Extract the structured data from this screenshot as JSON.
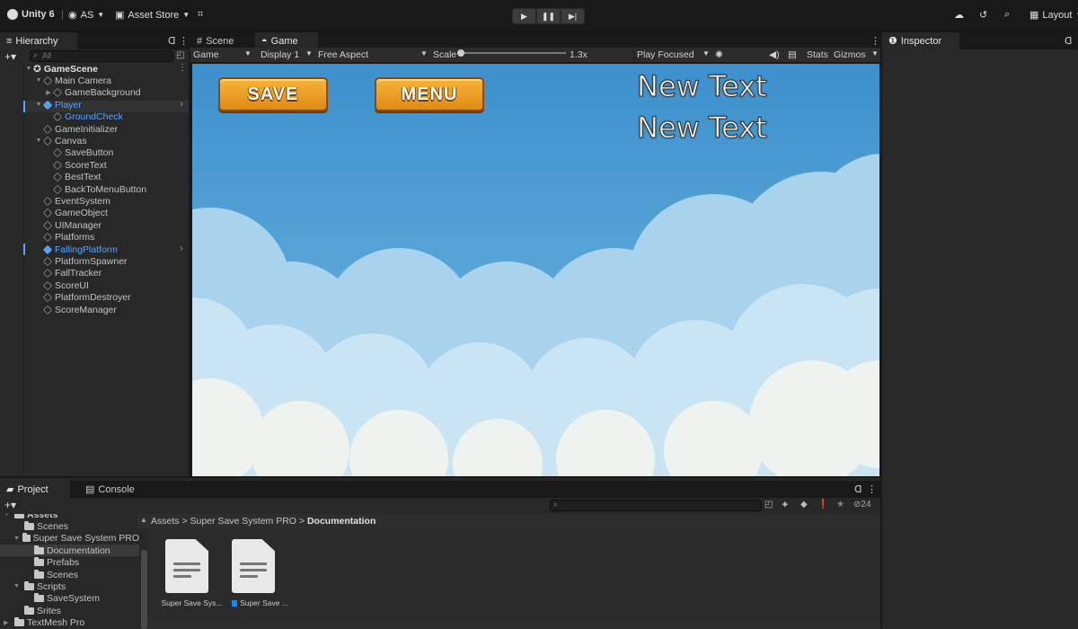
{
  "topbar": {
    "app": "Unity 6",
    "account": "AS",
    "asset_store": "Asset Store",
    "layout": "Layout"
  },
  "hierarchy": {
    "tab": "Hierarchy",
    "search_placeholder": "All",
    "items": [
      {
        "label": "GameScene",
        "indent": 0,
        "kind": "scene",
        "expanded": true
      },
      {
        "label": "Main Camera",
        "indent": 1,
        "kind": "object",
        "expanded": true
      },
      {
        "label": "GameBackground",
        "indent": 2,
        "kind": "object",
        "collapsed": true
      },
      {
        "label": "Player",
        "indent": 1,
        "kind": "prefab",
        "expanded": true
      },
      {
        "label": "GroundCheck",
        "indent": 2,
        "kind": "prefab-child"
      },
      {
        "label": "GameInitializer",
        "indent": 1,
        "kind": "object"
      },
      {
        "label": "Canvas",
        "indent": 1,
        "kind": "object",
        "expanded": true
      },
      {
        "label": "SaveButton",
        "indent": 2,
        "kind": "object"
      },
      {
        "label": "ScoreText",
        "indent": 2,
        "kind": "object"
      },
      {
        "label": "BestText",
        "indent": 2,
        "kind": "object"
      },
      {
        "label": "BackToMenuButton",
        "indent": 2,
        "kind": "object"
      },
      {
        "label": "EventSystem",
        "indent": 1,
        "kind": "object"
      },
      {
        "label": "GameObject",
        "indent": 1,
        "kind": "object"
      },
      {
        "label": "UIManager",
        "indent": 1,
        "kind": "object"
      },
      {
        "label": "Platforms",
        "indent": 1,
        "kind": "object"
      },
      {
        "label": "FallingPlatform",
        "indent": 1,
        "kind": "prefab"
      },
      {
        "label": "PlatformSpawner",
        "indent": 1,
        "kind": "object"
      },
      {
        "label": "FallTracker",
        "indent": 1,
        "kind": "object"
      },
      {
        "label": "ScoreUI",
        "indent": 1,
        "kind": "object"
      },
      {
        "label": "PlatformDestroyer",
        "indent": 1,
        "kind": "object"
      },
      {
        "label": "ScoreManager",
        "indent": 1,
        "kind": "object"
      }
    ]
  },
  "center_tabs": {
    "scene": "Scene",
    "game": "Game"
  },
  "game_toolbar": {
    "mode": "Game",
    "display": "Display 1",
    "aspect": "Free Aspect",
    "scale_label": "Scale",
    "scale_value": "1.3x",
    "play_mode": "Play Focused",
    "stats": "Stats",
    "gizmos": "Gizmos"
  },
  "game_view": {
    "save_button": "SAVE",
    "menu_button": "MENU",
    "text1": "New Text",
    "text2": "New Text"
  },
  "inspector": {
    "tab": "Inspector"
  },
  "bottom_tabs": {
    "project": "Project",
    "console": "Console"
  },
  "project": {
    "hidden_count": "24",
    "breadcrumb": [
      "Assets",
      "Super Save System PRO",
      "Documentation"
    ],
    "tree": [
      {
        "label": "Assets",
        "indent": 0,
        "open": true
      },
      {
        "label": "Scenes",
        "indent": 1
      },
      {
        "label": "Super Save System PRO",
        "indent": 1,
        "open": true
      },
      {
        "label": "Documentation",
        "indent": 2,
        "selected": true
      },
      {
        "label": "Prefabs",
        "indent": 2
      },
      {
        "label": "Scenes",
        "indent": 2
      },
      {
        "label": "Scripts",
        "indent": 1,
        "open": true
      },
      {
        "label": "SaveSystem",
        "indent": 2
      },
      {
        "label": "Srites",
        "indent": 1
      },
      {
        "label": "TextMesh Pro",
        "indent": 0,
        "collapsed": true
      }
    ],
    "files": [
      {
        "label": "Super Save Sys..."
      },
      {
        "label": "Super Save ..."
      }
    ]
  },
  "colors": {
    "accent": "#58a6ff",
    "selection": "#2c5d87"
  }
}
